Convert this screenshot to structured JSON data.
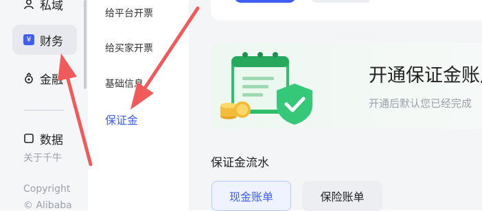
{
  "nav": {
    "items": [
      {
        "label": "私域",
        "icon": "people-icon"
      },
      {
        "label": "财务",
        "icon": "finance-icon"
      },
      {
        "label": "金融",
        "icon": "moneybag-icon"
      },
      {
        "label": "数据",
        "icon": "data-icon"
      }
    ],
    "footer": {
      "about": "关于千牛",
      "copyright": "Copyright",
      "alibaba": "© Alibaba"
    }
  },
  "submenu": {
    "items": [
      {
        "label": "给平台开票"
      },
      {
        "label": "给买家开票"
      },
      {
        "label": "基础信息"
      },
      {
        "label": "保证金"
      }
    ]
  },
  "main": {
    "banner": {
      "title": "开通保证金账户",
      "subtitle": "开通后默认您已经完成"
    },
    "flow": {
      "title": "保证金流水",
      "tabs": [
        "现金账单",
        "保险账单"
      ]
    }
  },
  "colors": {
    "accent": "#3e5ef6",
    "annotation_arrow": "#f05a5a"
  }
}
